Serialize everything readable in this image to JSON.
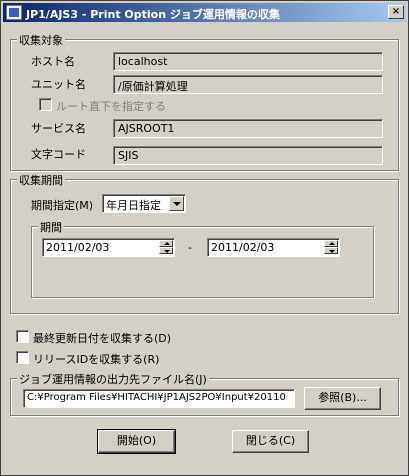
{
  "window": {
    "title": "JP1/AJS3 - Print Option ジョブ運用情報の収集",
    "close_glyph": "×"
  },
  "target": {
    "legend": "収集対象",
    "host_label": "ホスト名",
    "host_value": "localhost",
    "unit_label": "ユニット名",
    "unit_value": "/原価計算処理",
    "root_checkbox_label": "ルート直下を指定する",
    "service_label": "サービス名",
    "service_value": "AJSROOT1",
    "charcode_label": "文字コード",
    "charcode_value": "SJIS"
  },
  "period": {
    "legend": "収集期間",
    "spec_label": "期間指定(M)",
    "spec_value": "年月日指定",
    "range_legend": "期間",
    "start_date": "2011/02/03",
    "separator": "-",
    "end_date": "2011/02/03"
  },
  "options": {
    "latest_update_label": "最終更新日付を収集する(D)",
    "release_id_label": "リリースIDを収集する(R)"
  },
  "output": {
    "legend": "ジョブ運用情報の出力先ファイル名(J)",
    "path_value": "C:¥Program Files¥HITACHI¥JP1AJS2PO¥Input¥20110",
    "browse_label": "参照(B)..."
  },
  "buttons": {
    "start_label": "開始(O)",
    "close_label": "閉じる(C)"
  }
}
